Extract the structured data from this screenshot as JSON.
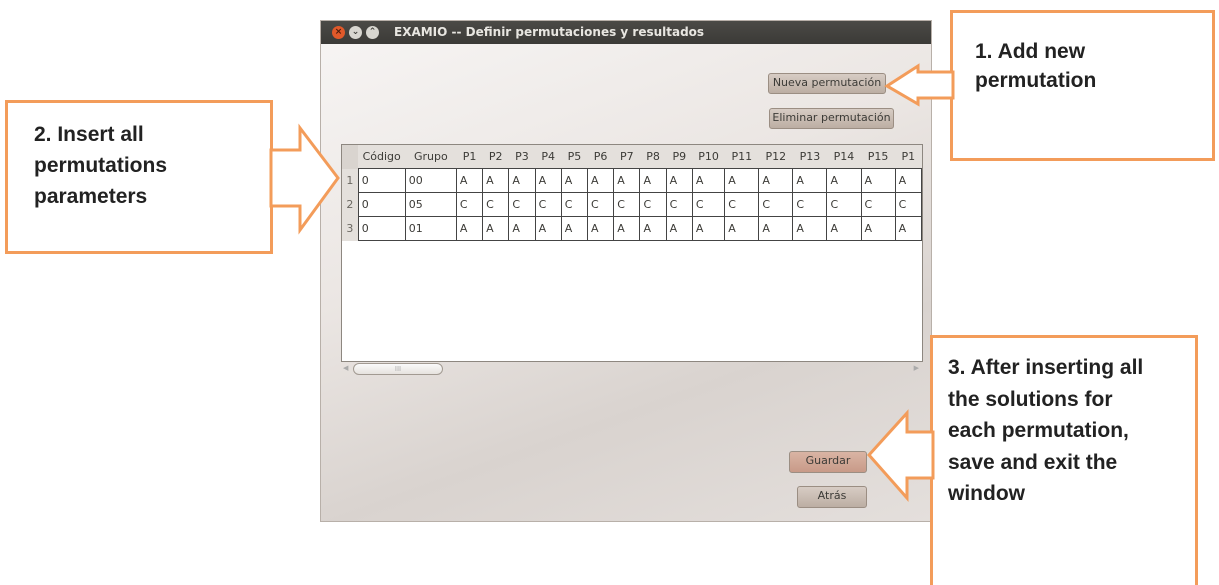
{
  "window": {
    "title": "EXAMIO  -- Definir permutaciones y resultados",
    "buttons": {
      "nueva": "Nueva permutación",
      "eliminar": "Eliminar permutación",
      "guardar": "Guardar",
      "atras": "Atrás"
    },
    "table": {
      "columns": [
        "Código",
        "Grupo",
        "P1",
        "P2",
        "P3",
        "P4",
        "P5",
        "P6",
        "P7",
        "P8",
        "P9",
        "P10",
        "P11",
        "P12",
        "P13",
        "P14",
        "P15",
        "P1"
      ],
      "rows": [
        {
          "n": "1",
          "cells": [
            "0",
            "00",
            "A",
            "A",
            "A",
            "A",
            "A",
            "A",
            "A",
            "A",
            "A",
            "A",
            "A",
            "A",
            "A",
            "A",
            "A",
            "A"
          ]
        },
        {
          "n": "2",
          "cells": [
            "0",
            "05",
            "C",
            "C",
            "C",
            "C",
            "C",
            "C",
            "C",
            "C",
            "C",
            "C",
            "C",
            "C",
            "C",
            "C",
            "C",
            "C"
          ]
        },
        {
          "n": "3",
          "cells": [
            "0",
            "01",
            "A",
            "A",
            "A",
            "A",
            "A",
            "A",
            "A",
            "A",
            "A",
            "A",
            "A",
            "A",
            "A",
            "A",
            "A",
            "A"
          ]
        }
      ]
    },
    "scroll_thumb_grip": "III"
  },
  "callouts": {
    "add": "1. Add new\npermutation",
    "insert": "2. Insert all\npermutations\nparameters",
    "save": "3. After inserting all\nthe solutions for\neach permutation,\nsave and exit the\nwindow"
  },
  "colors": {
    "callout_border": "#f39c5a",
    "titlebar": "#3b3a37",
    "close_button": "#e1592a"
  }
}
